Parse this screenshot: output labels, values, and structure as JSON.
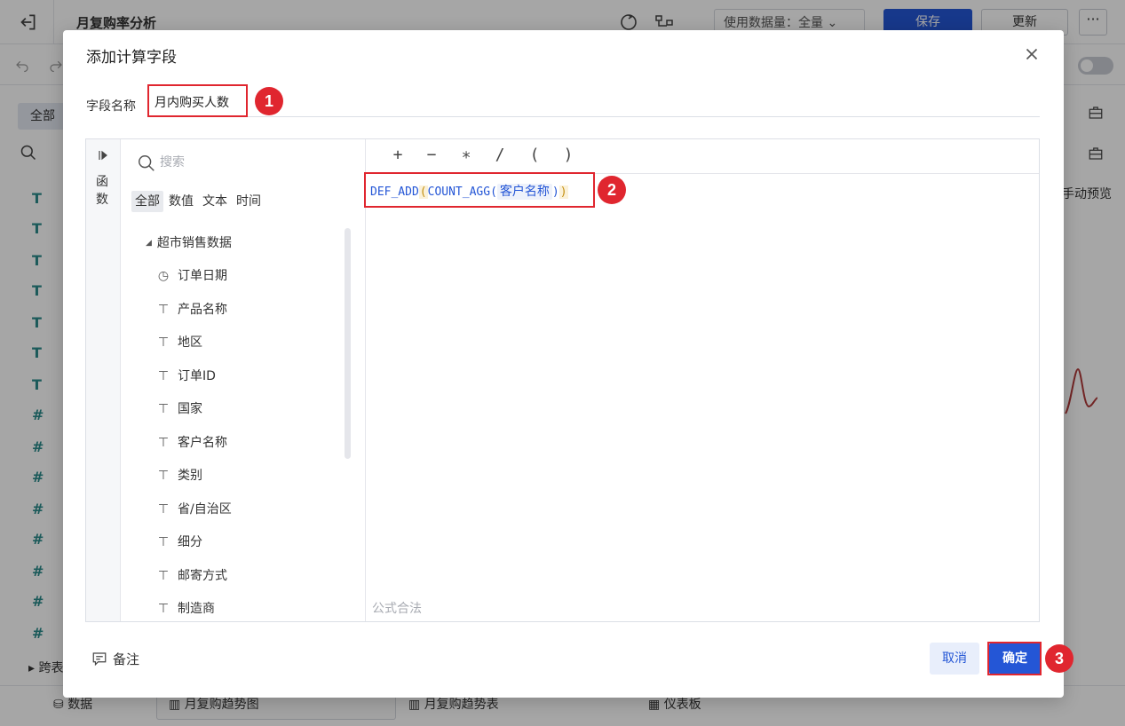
{
  "app": {
    "title": "月复购率分析",
    "data_usage": "使用数据量：全量",
    "save_label": "保存",
    "update_label": "更新",
    "more_label": "···"
  },
  "left_panel": {
    "tab_all": "全部",
    "cross_table": "跨表"
  },
  "right_panel": {
    "preview": "手动预览"
  },
  "bottom_bar": {
    "data": "数据",
    "tab1": "月复购趋势图",
    "tab2": "月复购趋势表",
    "tab3": "仪表板"
  },
  "dialog": {
    "title": "添加计算字段",
    "field_name_label": "字段名称",
    "field_name_value": "月内购买人数",
    "function_label": "函数",
    "search_placeholder": "搜索",
    "tabs": [
      "全部",
      "数值",
      "文本",
      "时间"
    ],
    "group": "超市销售数据",
    "fields": [
      {
        "type": "date",
        "name": "订单日期"
      },
      {
        "type": "text",
        "name": "产品名称"
      },
      {
        "type": "text",
        "name": "地区"
      },
      {
        "type": "text",
        "name": "订单ID"
      },
      {
        "type": "text",
        "name": "国家"
      },
      {
        "type": "text",
        "name": "客户名称"
      },
      {
        "type": "text",
        "name": "类别"
      },
      {
        "type": "text",
        "name": "省/自治区"
      },
      {
        "type": "text",
        "name": "细分"
      },
      {
        "type": "text",
        "name": "邮寄方式"
      },
      {
        "type": "text",
        "name": "制造商"
      }
    ],
    "operators": [
      "+",
      "−",
      "∗",
      "/",
      "(",
      ")"
    ],
    "formula": {
      "func_outer": "DEF_ADD",
      "func_inner": "COUNT_AGG(",
      "field": "客户名称",
      "close_inner": ")",
      "close_outer": ")"
    },
    "status": "公式合法",
    "note_label": "备注",
    "cancel_label": "取消",
    "ok_label": "确定"
  },
  "annotations": [
    "1",
    "2",
    "3"
  ],
  "colors": {
    "primary": "#2456d6",
    "highlight": "#e0262f",
    "field_teal": "#2a8a8a"
  }
}
